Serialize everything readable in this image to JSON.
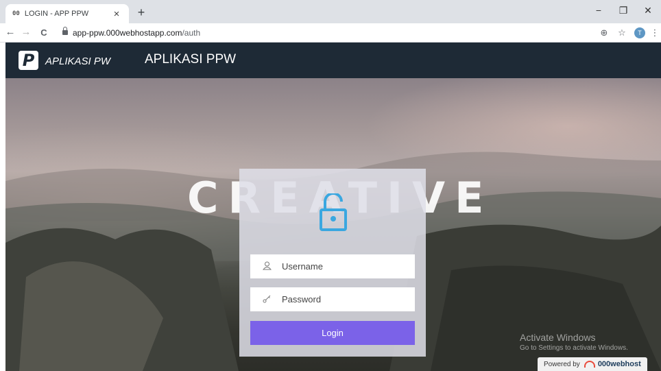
{
  "browser": {
    "tab": {
      "favicon": "00",
      "title": "LOGIN - APP PPW",
      "close_icon": "×"
    },
    "new_tab_icon": "+",
    "window_controls": {
      "minimize": "−",
      "restore": "❐",
      "close": "✕"
    },
    "nav": {
      "back": "←",
      "forward": "→",
      "reload": "C"
    },
    "url": {
      "domain": "app-ppw.000webhostapp.com",
      "path": "/auth"
    },
    "address_icons": {
      "zoom": "⊕",
      "star": "☆",
      "menu": "⋮"
    },
    "profile_initial": "T"
  },
  "navbar": {
    "logo_letter": "P",
    "brand": "APLIKASI PW",
    "title": "APLIKASI PPW",
    "background": "#1e2a36"
  },
  "hero": {
    "overlay_word": "CREATIVE"
  },
  "login": {
    "lock_icon": "unlock-icon",
    "lock_color": "#3aa7e0",
    "username_placeholder": "Username",
    "password_placeholder": "Password",
    "username_icon": "user-icon",
    "password_icon": "key-icon",
    "button_label": "Login",
    "button_color": "#7b62e8"
  },
  "watermark": {
    "title": "Activate Windows",
    "subtitle": "Go to Settings to activate Windows."
  },
  "powered": {
    "prefix": "Powered by",
    "host": "000webhost"
  }
}
